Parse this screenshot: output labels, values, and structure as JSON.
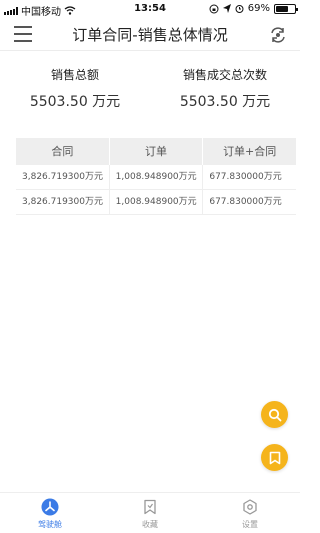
{
  "status_bar": {
    "carrier": "中国移动",
    "time": "13:54",
    "battery_percent": "69%",
    "battery_level": 0.69
  },
  "nav": {
    "title": "订单合同-销售总体情况"
  },
  "summary": {
    "total_sales_label": "销售总额",
    "total_sales_value": "5503.50 万元",
    "deal_count_label": "销售成交总次数",
    "deal_count_value": "5503.50 万元"
  },
  "table": {
    "columns": [
      "合同",
      "订单",
      "订单+合同"
    ],
    "rows": [
      [
        "3,826.719300万元",
        "1,008.948900万元",
        "677.830000万元"
      ],
      [
        "3,826.719300万元",
        "1,008.948900万元",
        "677.830000万元"
      ]
    ]
  },
  "fabs": {
    "search_icon": "search-icon",
    "bookmark_icon": "bookmark-icon"
  },
  "tab_bar": {
    "tabs": [
      {
        "label": "驾驶舱",
        "icon": "cockpit-icon",
        "active": true
      },
      {
        "label": "收藏",
        "icon": "bookmark-icon",
        "active": false
      },
      {
        "label": "设置",
        "icon": "settings-icon",
        "active": false
      }
    ]
  },
  "colors": {
    "accent": "#3b7be6",
    "fab": "#f5b41c"
  }
}
